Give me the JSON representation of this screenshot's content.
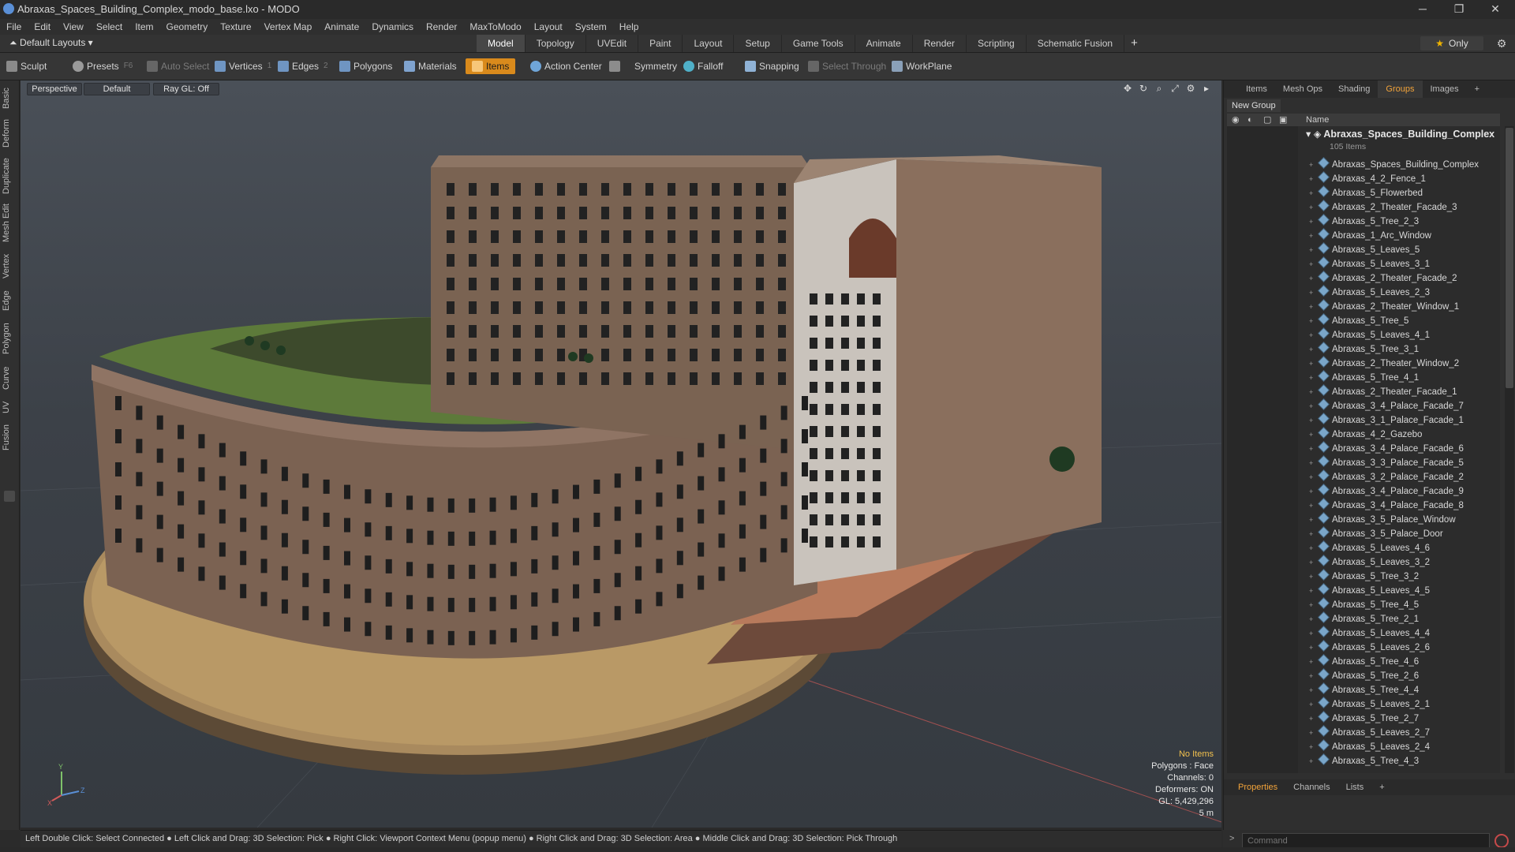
{
  "window": {
    "title": "Abraxas_Spaces_Building_Complex_modo_base.lxo - MODO"
  },
  "menu": [
    "File",
    "Edit",
    "View",
    "Select",
    "Item",
    "Geometry",
    "Texture",
    "Vertex Map",
    "Animate",
    "Dynamics",
    "Render",
    "MaxToModo",
    "Layout",
    "System",
    "Help"
  ],
  "layoutbar": {
    "layout_label": "Default Layouts",
    "tabs": [
      "Model",
      "Topology",
      "UVEdit",
      "Paint",
      "Layout",
      "Setup",
      "Game Tools",
      "Animate",
      "Render",
      "Scripting",
      "Schematic Fusion"
    ],
    "active_tab": "Model",
    "only_label": "Only"
  },
  "toolbar": {
    "sculpt": "Sculpt",
    "presets": "Presets",
    "presets_key": "F6",
    "auto_select": "Auto Select",
    "vertices": "Vertices",
    "vertices_key": "1",
    "edges": "Edges",
    "edges_key": "2",
    "polygons": "Polygons",
    "materials": "Materials",
    "items": "Items",
    "action_center": "Action Center",
    "symmetry": "Symmetry",
    "falloff": "Falloff",
    "snapping": "Snapping",
    "select_through": "Select Through",
    "workplane": "WorkPlane"
  },
  "left_palette": [
    "Basic",
    "Deform",
    "Duplicate",
    "Mesh Edit",
    "Vertex",
    "Edge",
    "Polygon",
    "Curve",
    "UV",
    "Fusion"
  ],
  "viewport": {
    "view": "Perspective",
    "shading": "Default",
    "raygl": "Ray GL: Off",
    "info": {
      "no_items": "No Items",
      "polygons": "Polygons : Face",
      "channels": "Channels: 0",
      "deformers": "Deformers: ON",
      "gl": "GL: 5,429,296",
      "scale": "5 m"
    },
    "axis": {
      "x": "X",
      "y": "Y",
      "z": "Z"
    }
  },
  "right_panel": {
    "tabs": [
      "Items",
      "Mesh Ops",
      "Shading",
      "Groups",
      "Images"
    ],
    "active_tab": "Groups",
    "new_group": "New Group",
    "name_header": "Name",
    "group_name": "Abraxas_Spaces_Building_Complex",
    "group_count": "105 Items",
    "items": [
      "Abraxas_Spaces_Building_Complex",
      "Abraxas_4_2_Fence_1",
      "Abraxas_5_Flowerbed",
      "Abraxas_2_Theater_Facade_3",
      "Abraxas_5_Tree_2_3",
      "Abraxas_1_Arc_Window",
      "Abraxas_5_Leaves_5",
      "Abraxas_5_Leaves_3_1",
      "Abraxas_2_Theater_Facade_2",
      "Abraxas_5_Leaves_2_3",
      "Abraxas_2_Theater_Window_1",
      "Abraxas_5_Tree_5",
      "Abraxas_5_Leaves_4_1",
      "Abraxas_5_Tree_3_1",
      "Abraxas_2_Theater_Window_2",
      "Abraxas_5_Tree_4_1",
      "Abraxas_2_Theater_Facade_1",
      "Abraxas_3_4_Palace_Facade_7",
      "Abraxas_3_1_Palace_Facade_1",
      "Abraxas_4_2_Gazebo",
      "Abraxas_3_4_Palace_Facade_6",
      "Abraxas_3_3_Palace_Facade_5",
      "Abraxas_3_2_Palace_Facade_2",
      "Abraxas_3_4_Palace_Facade_9",
      "Abraxas_3_4_Palace_Facade_8",
      "Abraxas_3_5_Palace_Window",
      "Abraxas_3_5_Palace_Door",
      "Abraxas_5_Leaves_4_6",
      "Abraxas_5_Leaves_3_2",
      "Abraxas_5_Tree_3_2",
      "Abraxas_5_Leaves_4_5",
      "Abraxas_5_Tree_4_5",
      "Abraxas_5_Tree_2_1",
      "Abraxas_5_Leaves_4_4",
      "Abraxas_5_Leaves_2_6",
      "Abraxas_5_Tree_4_6",
      "Abraxas_5_Tree_2_6",
      "Abraxas_5_Tree_4_4",
      "Abraxas_5_Leaves_2_1",
      "Abraxas_5_Tree_2_7",
      "Abraxas_5_Leaves_2_7",
      "Abraxas_5_Leaves_2_4",
      "Abraxas_5_Tree_4_3"
    ],
    "bottom_tabs": [
      "Properties",
      "Channels",
      "Lists"
    ],
    "bottom_active": "Properties"
  },
  "statusbar": {
    "text": "Left Double Click: Select Connected ● Left Click and Drag: 3D Selection: Pick ● Right Click: Viewport Context Menu (popup menu) ● Right Click and Drag: 3D Selection: Area ● Middle Click and Drag: 3D Selection: Pick Through"
  },
  "command": {
    "placeholder": "Command"
  },
  "colors": {
    "accent": "#f2a33a",
    "items_button": "#d98a1c",
    "info_highlight": "#f2c14e"
  }
}
